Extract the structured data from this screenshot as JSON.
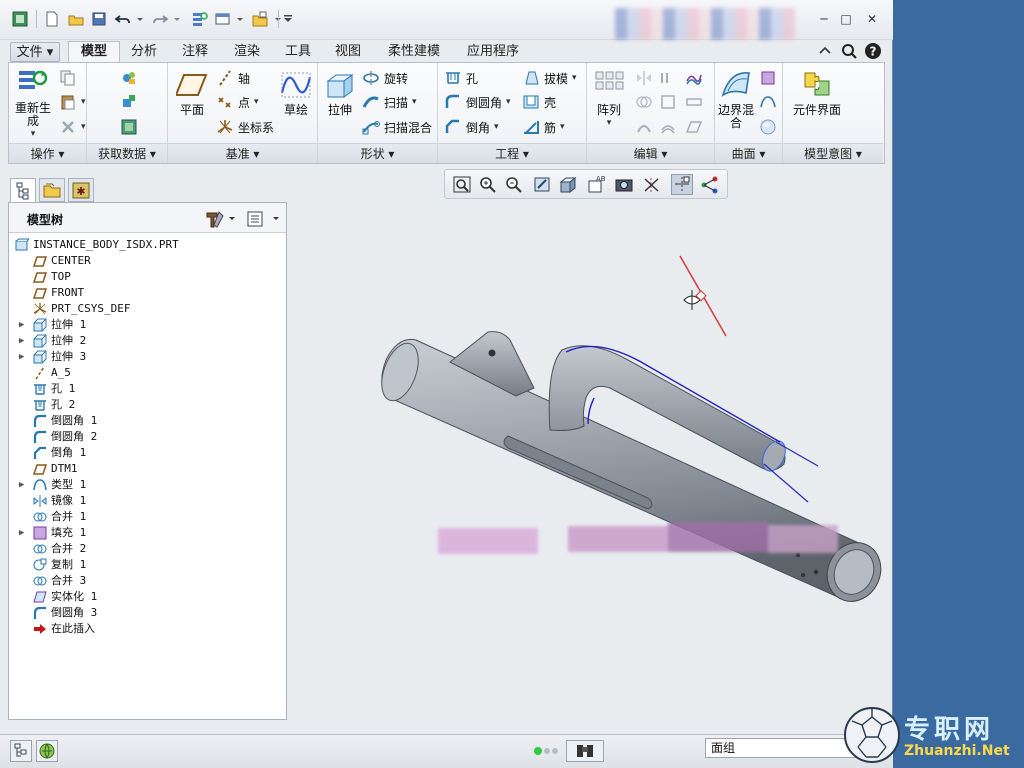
{
  "titlebar": {
    "app_icon": "creo-app-icon",
    "controls": {
      "help": "?",
      "minimize": "─",
      "maximize": "□",
      "close": "✕"
    }
  },
  "tabs": [
    {
      "label": "文件",
      "id": "file"
    },
    {
      "label": "模型",
      "id": "model",
      "active": true
    },
    {
      "label": "分析",
      "id": "analysis"
    },
    {
      "label": "注释",
      "id": "annotate"
    },
    {
      "label": "渲染",
      "id": "render"
    },
    {
      "label": "工具",
      "id": "tools"
    },
    {
      "label": "视图",
      "id": "view"
    },
    {
      "label": "柔性建模",
      "id": "flex"
    },
    {
      "label": "应用程序",
      "id": "apps"
    }
  ],
  "ribbon": {
    "groups": {
      "operations": "操作",
      "getdata": "获取数据",
      "datum": "基准",
      "shapes": "形状",
      "engineering": "工程",
      "editing": "编辑",
      "surfaces": "曲面",
      "intent": "模型意图"
    },
    "buttons": {
      "regenerate": "重新生成",
      "plane": "平面",
      "axis": "轴",
      "point": "点",
      "csys": "坐标系",
      "sketch": "草绘",
      "extrude": "拉伸",
      "revolve": "旋转",
      "sweep": "扫描",
      "swept_blend": "扫描混合",
      "hole": "孔",
      "round": "倒圆角",
      "chamfer": "倒角",
      "draft": "拔模",
      "shell": "壳",
      "rib": "筋",
      "pattern": "阵列",
      "boundary_blend": "边界混合",
      "component_interface": "元件界面"
    }
  },
  "tree": {
    "title": "模型树",
    "items": [
      {
        "label": "INSTANCE_BODY_ISDX.PRT",
        "icon": "part-icon",
        "level": 0
      },
      {
        "label": "CENTER",
        "icon": "datum-plane-icon",
        "level": 1
      },
      {
        "label": "TOP",
        "icon": "datum-plane-icon",
        "level": 1
      },
      {
        "label": "FRONT",
        "icon": "datum-plane-icon",
        "level": 1
      },
      {
        "label": "PRT_CSYS_DEF",
        "icon": "csys-icon",
        "level": 1
      },
      {
        "label": "拉伸 1",
        "icon": "extrude-icon",
        "level": 1,
        "expandable": true
      },
      {
        "label": "拉伸 2",
        "icon": "extrude-icon",
        "level": 1,
        "expandable": true
      },
      {
        "label": "拉伸 3",
        "icon": "extrude-icon",
        "level": 1,
        "expandable": true
      },
      {
        "label": "A_5",
        "icon": "axis-icon",
        "level": 1
      },
      {
        "label": "孔 1",
        "icon": "hole-icon",
        "level": 1
      },
      {
        "label": "孔 2",
        "icon": "hole-icon",
        "level": 1
      },
      {
        "label": "倒圆角 1",
        "icon": "round-icon",
        "level": 1
      },
      {
        "label": "倒圆角 2",
        "icon": "round-icon",
        "level": 1
      },
      {
        "label": "倒角 1",
        "icon": "chamfer-icon",
        "level": 1
      },
      {
        "label": "DTM1",
        "icon": "datum-plane-icon",
        "level": 1
      },
      {
        "label": "类型 1",
        "icon": "style-icon",
        "level": 1,
        "expandable": true
      },
      {
        "label": "镜像 1",
        "icon": "mirror-icon",
        "level": 1
      },
      {
        "label": "合并 1",
        "icon": "merge-icon",
        "level": 1
      },
      {
        "label": "填充 1",
        "icon": "fill-icon",
        "level": 1,
        "expandable": true
      },
      {
        "label": "合并 2",
        "icon": "merge-icon",
        "level": 1
      },
      {
        "label": "复制 1",
        "icon": "copy-icon",
        "level": 1
      },
      {
        "label": "合并 3",
        "icon": "merge-icon",
        "level": 1
      },
      {
        "label": "实体化 1",
        "icon": "solidify-icon",
        "level": 1
      },
      {
        "label": "倒圆角 3",
        "icon": "round-icon",
        "level": 1
      },
      {
        "label": "在此插入",
        "icon": "insert-arrow-icon",
        "level": 1
      }
    ]
  },
  "status": {
    "filter_value": "面组"
  },
  "watermark": {
    "cn": "专职网",
    "en": "Zhuanzhi.Net"
  },
  "colors": {
    "accent": "#1f4f9a",
    "model_gray": "#9aa2ab",
    "app_bg": "#e9ecef",
    "desktop": "#3a6aa0"
  }
}
